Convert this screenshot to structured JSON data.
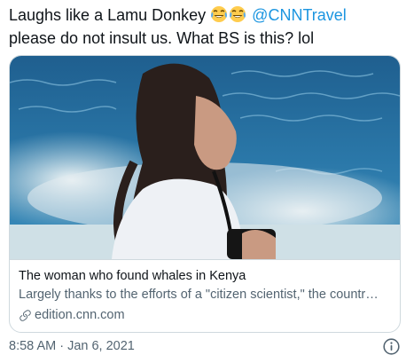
{
  "tweet": {
    "text_before": "Laughs like a Lamu Donkey",
    "emoji": [
      "face-with-tears-of-joy-emoji",
      "face-with-tears-of-joy-emoji"
    ],
    "mention": "@CNNTravel",
    "text_after": "please do not insult us. What BS is this? lol"
  },
  "card": {
    "image": "woman-with-camera-by-ocean",
    "title": "The woman who found whales in Kenya",
    "description": "Largely thanks to the efforts of a \"citizen scientist,\" the countr…",
    "domain": "edition.cnn.com",
    "domain_icon": "link-icon"
  },
  "meta": {
    "timestamp": "8:58 AM · Jan 6, 2021",
    "info_icon": "info-icon"
  },
  "colors": {
    "mention": "#1b95e0",
    "border": "#cfd9de",
    "secondary_text": "#536471",
    "primary_text": "#0f1419"
  }
}
